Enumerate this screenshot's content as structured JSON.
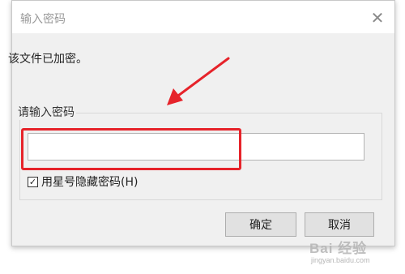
{
  "dialog": {
    "title": "输入密码",
    "close_glyph": "✕",
    "message": "该文件已加密。",
    "group_label": "请输入密码",
    "password_value": "",
    "mask_checkbox": {
      "checked": true,
      "check_glyph": "✓",
      "label": "用星号隐藏密码(H)"
    },
    "ok_label": "确定",
    "cancel_label": "取消"
  },
  "annotation": {
    "highlight_color": "#e6232a",
    "arrow_color": "#e6232a"
  },
  "watermark": {
    "main": "Bai 经验",
    "sub": "jingyan.baidu.com"
  }
}
